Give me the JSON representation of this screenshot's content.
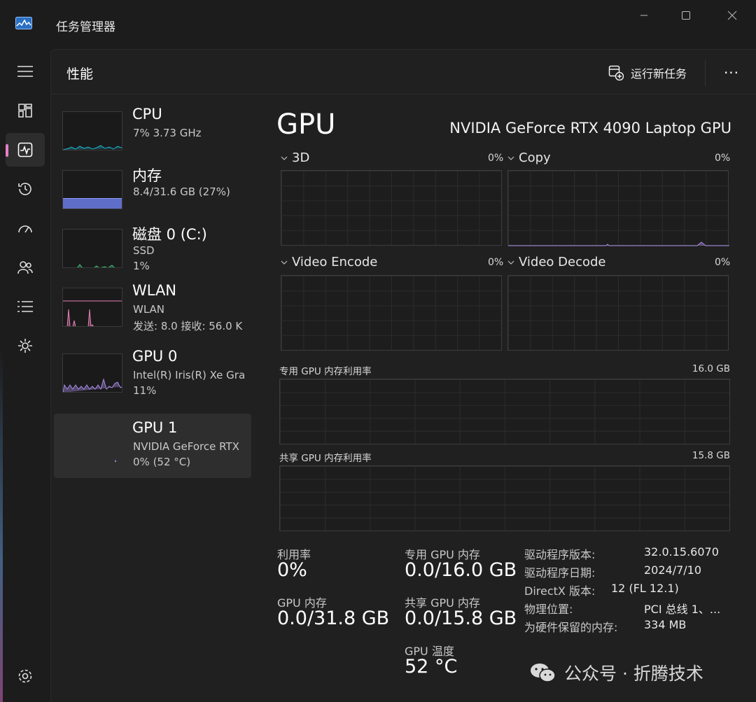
{
  "window": {
    "title": "任务管理器"
  },
  "header": {
    "page_title": "性能",
    "run_new_task": "运行新任务",
    "more": "···"
  },
  "nav": [
    {
      "icon": "hamburger-menu-icon"
    },
    {
      "icon": "processes-icon"
    },
    {
      "icon": "performance-icon",
      "active": true
    },
    {
      "icon": "app-history-icon"
    },
    {
      "icon": "startup-apps-icon"
    },
    {
      "icon": "users-icon"
    },
    {
      "icon": "details-icon"
    },
    {
      "icon": "services-icon"
    },
    {
      "icon": "settings-icon"
    }
  ],
  "devices": [
    {
      "name": "CPU",
      "line2": "7% 3.73 GHz",
      "line3": "",
      "color": "#1fb0c9"
    },
    {
      "name": "内存",
      "line2": "8.4/31.6 GB (27%)",
      "line3": "",
      "color": "#7d8be8",
      "fill": 0.27
    },
    {
      "name": "磁盘 0 (C:)",
      "line2": "SSD",
      "line3": "1%",
      "color": "#3cc27a"
    },
    {
      "name": "WLAN",
      "line2": "WLAN",
      "line3": "发送: 8.0 接收: 56.0 K",
      "color": "#e67fb4"
    },
    {
      "name": "GPU 0",
      "line2": "Intel(R) Iris(R) Xe Gra",
      "line3": "11%",
      "color": "#a98ce8"
    },
    {
      "name": "GPU 1",
      "line2": "NVIDIA GeForce RTX",
      "line3": "0% (52 °C)",
      "color": "#a98ce8",
      "selected": true
    }
  ],
  "gpu": {
    "title": "GPU",
    "model": "NVIDIA GeForce RTX 4090 Laptop GPU",
    "engines": [
      {
        "name": "3D",
        "pct": "0%"
      },
      {
        "name": "Copy",
        "pct": "0%"
      },
      {
        "name": "Video Encode",
        "pct": "0%"
      },
      {
        "name": "Video Decode",
        "pct": "0%"
      }
    ],
    "dedicated_mem": {
      "label": "专用 GPU 内存利用率",
      "max": "16.0 GB"
    },
    "shared_mem": {
      "label": "共享 GPU 内存利用率",
      "max": "15.8 GB"
    },
    "stats": {
      "utilization": {
        "label": "利用率",
        "value": "0%"
      },
      "dedicated": {
        "label": "专用 GPU 内存",
        "value": "0.0/16.0 GB"
      },
      "gpu_memory": {
        "label": "GPU 内存",
        "value": "0.0/31.8 GB"
      },
      "shared": {
        "label": "共享 GPU 内存",
        "value": "0.0/15.8 GB"
      },
      "temperature": {
        "label": "GPU 温度",
        "value": "52 °C"
      }
    },
    "info": [
      {
        "key": "驱动程序版本:",
        "value": "32.0.15.6070"
      },
      {
        "key": "驱动程序日期:",
        "value": "2024/7/10"
      },
      {
        "key": "DirectX 版本:",
        "value": "12 (FL 12.1)"
      },
      {
        "key": "物理位置:",
        "value": "PCI 总线 1、..."
      },
      {
        "key": "为硬件保留的内存:",
        "value": "334 MB"
      }
    ]
  },
  "watermark": {
    "text": "公众号 · 折腾技术"
  },
  "colors": {
    "accent": "#e67fc7",
    "background": "#202020",
    "graph_line": "#2c2c2c"
  }
}
